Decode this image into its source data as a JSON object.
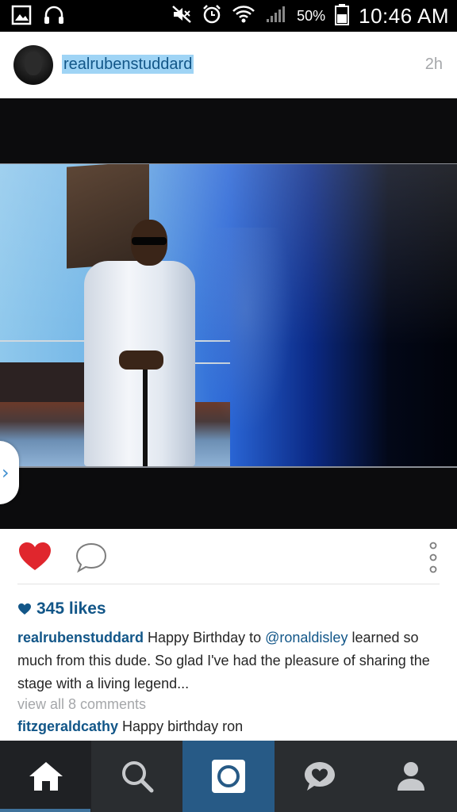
{
  "status_bar": {
    "battery_percent": "50%",
    "time": "10:46 AM",
    "icons": [
      "image-icon",
      "headphones-icon",
      "mute-icon",
      "alarm-icon",
      "wifi-icon",
      "signal-icon",
      "battery-icon"
    ]
  },
  "post": {
    "username": "realrubenstuddard",
    "time_ago": "2h",
    "likes_count": "345 likes",
    "caption": {
      "user": "realrubenstuddard",
      "text_before": " Happy Birthday to ",
      "mention": "@ronaldisley",
      "text_after": " learned so much from this dude. So glad I've had the pleasure of sharing the stage with a living legend..."
    },
    "view_comments": "view all 8 comments",
    "comments": [
      {
        "user": "fitzgeraldcathy",
        "text": " Happy birthday ron"
      }
    ]
  },
  "colors": {
    "link_blue": "#125688",
    "heart_red": "#ed4956",
    "nav_bg": "#2a2d30",
    "camera_bg": "#275a86",
    "username_highlight": "#9fd4f5"
  },
  "bottom_nav": {
    "items": [
      "home-icon",
      "search-icon",
      "camera-icon",
      "activity-icon",
      "profile-icon"
    ],
    "active": "home-icon"
  }
}
